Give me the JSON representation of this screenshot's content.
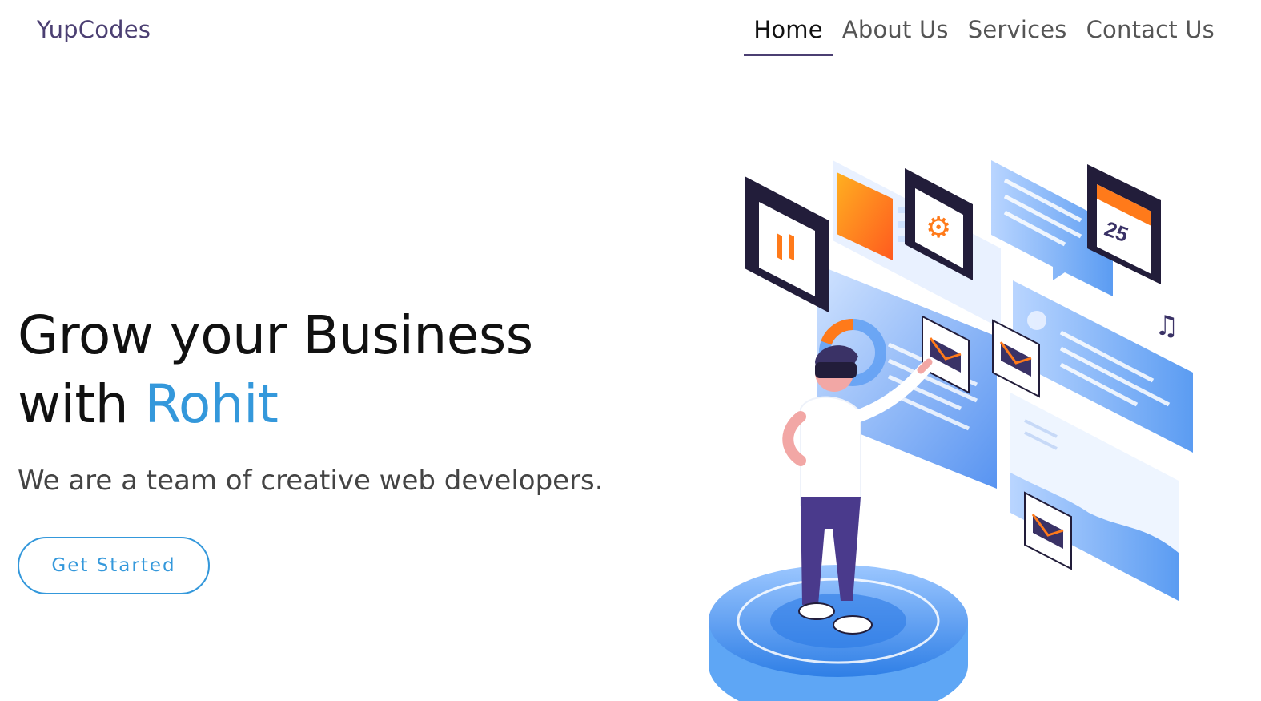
{
  "navbar": {
    "brand": "YupCodes",
    "links": [
      {
        "label": "Home",
        "active": true
      },
      {
        "label": "About Us",
        "active": false
      },
      {
        "label": "Services",
        "active": false
      },
      {
        "label": "Contact Us",
        "active": false
      }
    ]
  },
  "hero": {
    "title_line1": "Grow your Business",
    "title_with": "with",
    "title_highlight": "Rohit",
    "subtitle": "We are a team of creative web developers.",
    "cta_label": "Get Started"
  },
  "illustration": {
    "calendar_day": "25",
    "music_icon": "♫"
  },
  "colors": {
    "brand": "#4b3f72",
    "accent": "#3498db",
    "illustration_blue": "#5b9cf2",
    "illustration_orange": "#ff7a1a",
    "illustration_navy": "#221d3a"
  }
}
